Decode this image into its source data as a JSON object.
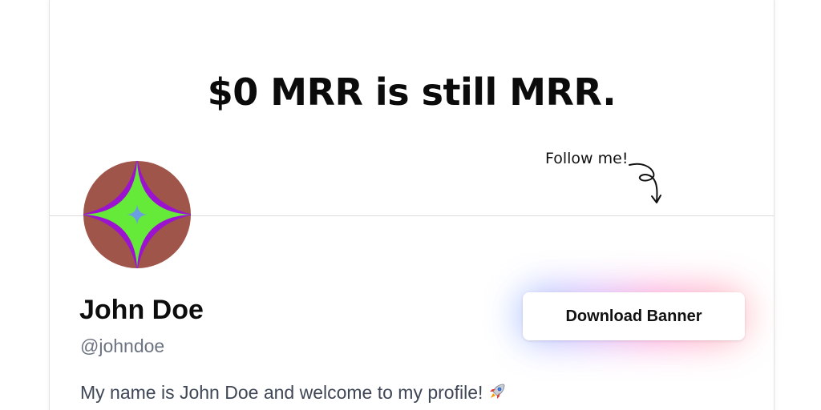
{
  "banner": {
    "title": "$0 MRR is still MRR.",
    "follow_text": "Follow me!",
    "arrow_icon": "curly-arrow-down-icon"
  },
  "profile": {
    "avatar_icon": "star-avatar-icon",
    "avatar_colors": {
      "background": "#a0554a",
      "outer_star": "#9b12cf",
      "inner_star": "#66ea3a",
      "center": "#6a9ee0"
    },
    "name": "John Doe",
    "handle": "@johndoe",
    "bio": "My name is John Doe and welcome to my profile!",
    "bio_icon": "rocket-icon"
  },
  "actions": {
    "download_label": "Download Banner",
    "glow_colors": [
      "#8fb8ff",
      "#c9a8ff",
      "#ff8fd0",
      "#ffb0b0"
    ]
  }
}
